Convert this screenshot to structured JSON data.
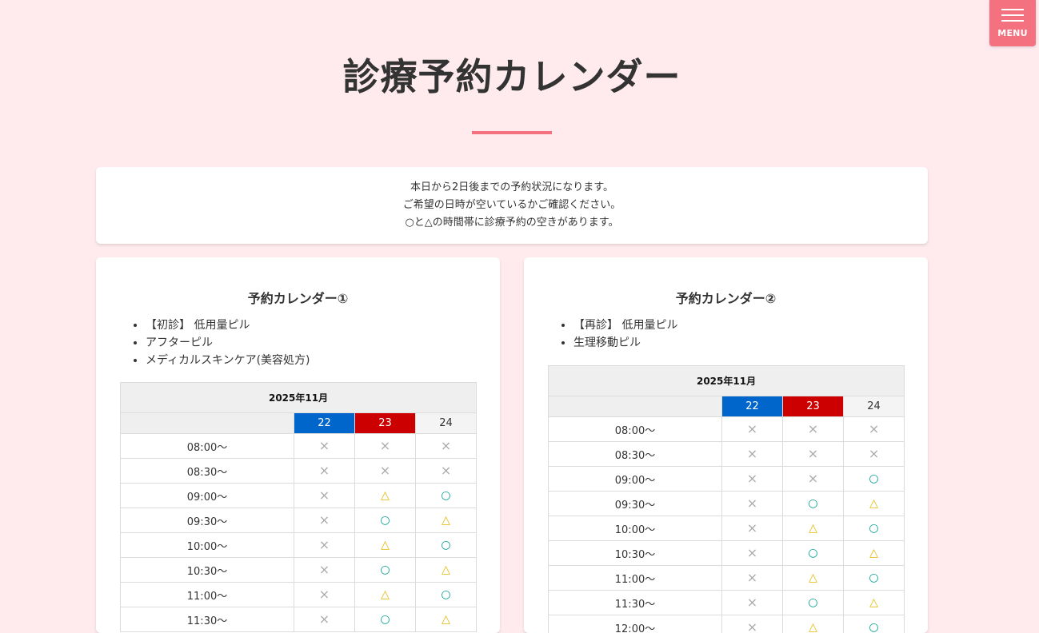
{
  "menu": {
    "label": "MENU"
  },
  "page": {
    "title": "診療予約カレンダー"
  },
  "notice": {
    "lines": [
      "本日から2日後までの予約状況になります。",
      "ご希望の日時が空いているかご確認ください。",
      "○と△の時間帯に診療予約の空きがあります。"
    ]
  },
  "colors": {
    "accent": "#f4717f",
    "background": "#ffebee",
    "day_blue": "#0066cc",
    "day_red": "#cc0000",
    "circle": "#009e8e",
    "triangle": "#e6b800",
    "cross": "#aaaaaa"
  },
  "calendars": [
    {
      "title": "予約カレンダー①",
      "items": [
        "【初診】 低用量ピル",
        "アフターピル",
        "メディカルスキンケア(美容処方)"
      ],
      "month": "2025年11月",
      "days": [
        "22",
        "23",
        "24"
      ],
      "rows": [
        {
          "time": "08:00～",
          "slots": [
            "×",
            "×",
            "×"
          ]
        },
        {
          "time": "08:30～",
          "slots": [
            "×",
            "×",
            "×"
          ]
        },
        {
          "time": "09:00～",
          "slots": [
            "×",
            "△",
            "○"
          ]
        },
        {
          "time": "09:30～",
          "slots": [
            "×",
            "○",
            "△"
          ]
        },
        {
          "time": "10:00～",
          "slots": [
            "×",
            "△",
            "○"
          ]
        },
        {
          "time": "10:30～",
          "slots": [
            "×",
            "○",
            "△"
          ]
        },
        {
          "time": "11:00～",
          "slots": [
            "×",
            "△",
            "○"
          ]
        },
        {
          "time": "11:30～",
          "slots": [
            "×",
            "○",
            "△"
          ]
        }
      ]
    },
    {
      "title": "予約カレンダー②",
      "items": [
        "【再診】 低用量ピル",
        "生理移動ピル"
      ],
      "month": "2025年11月",
      "days": [
        "22",
        "23",
        "24"
      ],
      "rows": [
        {
          "time": "08:00～",
          "slots": [
            "×",
            "×",
            "×"
          ]
        },
        {
          "time": "08:30～",
          "slots": [
            "×",
            "×",
            "×"
          ]
        },
        {
          "time": "09:00～",
          "slots": [
            "×",
            "×",
            "○"
          ]
        },
        {
          "time": "09:30～",
          "slots": [
            "×",
            "○",
            "△"
          ]
        },
        {
          "time": "10:00～",
          "slots": [
            "×",
            "△",
            "○"
          ]
        },
        {
          "time": "10:30～",
          "slots": [
            "×",
            "○",
            "△"
          ]
        },
        {
          "time": "11:00～",
          "slots": [
            "×",
            "△",
            "○"
          ]
        },
        {
          "time": "11:30～",
          "slots": [
            "×",
            "○",
            "△"
          ]
        },
        {
          "time": "12:00～",
          "slots": [
            "×",
            "△",
            "○"
          ]
        }
      ]
    }
  ]
}
